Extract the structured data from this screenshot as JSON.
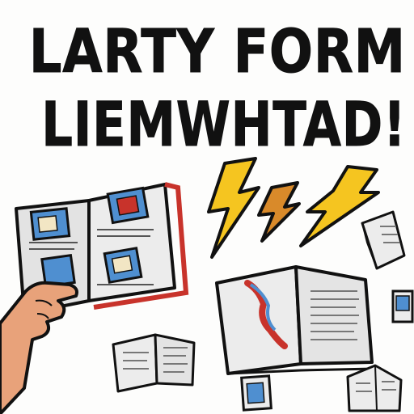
{
  "title": {
    "line1": "LARTY FORM",
    "line2": "LIEMWHTAD!"
  },
  "illustration": {
    "icons": [
      "open-book-icon",
      "lightning-bolt-icon",
      "hand-icon"
    ],
    "colors": {
      "bolt_primary": "#f5c520",
      "bolt_secondary": "#d98a2a",
      "ink": "#111111",
      "page": "#e9e9e9",
      "book_red": "#c8332b",
      "skin": "#e8a27a",
      "photo_blue": "#4f8fd0"
    }
  }
}
